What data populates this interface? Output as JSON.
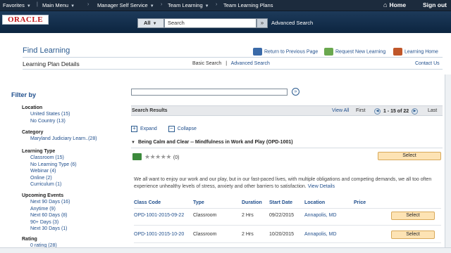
{
  "topnav": {
    "favorites": "Favorites",
    "main_menu": "Main Menu",
    "breadcrumb": [
      "Manager Self Service",
      "Team Learning",
      "Team Learning Plans"
    ],
    "home": "Home",
    "sign_out": "Sign out"
  },
  "brand": {
    "logo": "ORACLE",
    "scope": "All",
    "search_value": "Search",
    "advanced_search": "Advanced Search"
  },
  "header": {
    "title": "Find Learning",
    "subtitle": "Learning Plan Details",
    "links": {
      "return": "Return to Previous Page",
      "request": "Request New Learning",
      "learning_home": "Learning Home"
    },
    "basic_search": "Basic Search",
    "separator": "|",
    "advanced_search": "Advanced Search",
    "contact_us": "Contact Us"
  },
  "filters": {
    "title": "Filter by",
    "groups": [
      {
        "heading": "Location",
        "options": [
          "United States (15)",
          "No Country (13)"
        ]
      },
      {
        "heading": "Category",
        "options": [
          "Maryland Judiciary Learn..(28)"
        ]
      },
      {
        "heading": "Learning Type",
        "options": [
          "Classroom (15)",
          "No Learning Type (6)",
          "Webinar (4)",
          "Online (2)",
          "Curriculum (1)"
        ]
      },
      {
        "heading": "Upcoming Events",
        "options": [
          "Next 90 Days (16)",
          "Anytime (9)",
          "Next 60 Days (8)",
          "90+ Days (3)",
          "Next 30 Days (1)"
        ]
      },
      {
        "heading": "Rating",
        "options": [
          "0 rating (28)"
        ]
      }
    ]
  },
  "results": {
    "bar_title": "Search Results",
    "view_all": "View All",
    "first": "First",
    "range": "1 - 15 of 22",
    "last": "Last",
    "expand": "Expand",
    "collapse": "Collapse",
    "course_title": "Being Calm and Clear -- Mindfulness in Work and Play (OPD-1001)",
    "rating_count": "(0)",
    "select_label": "Select",
    "description": "We all want to enjoy our work and our play, but in our fast-paced lives, with multiple obligations and competing demands, we all too often experience unhealthy levels of stress, anxiety and other barriers to satisfaction.",
    "view_details": "View Details",
    "columns": [
      "Class Code",
      "Type",
      "Duration",
      "Start Date",
      "Location",
      "Price"
    ],
    "rows": [
      {
        "code": "OPD-1001-2015-09-22",
        "type": "Classroom",
        "duration": "2 Hrs",
        "start": "09/22/2015",
        "location": "Annapolis, MD",
        "select": "Select"
      },
      {
        "code": "OPD-1001-2015-10-20",
        "type": "Classroom",
        "duration": "2 Hrs",
        "start": "10/20/2015",
        "location": "Annapolis, MD",
        "select": "Select"
      }
    ]
  },
  "colors": {
    "nav_bg": "#1c2b3d",
    "brand_bg": "#0f2a45",
    "link": "#1f4e8c",
    "select_bg": "#fde3b4"
  }
}
